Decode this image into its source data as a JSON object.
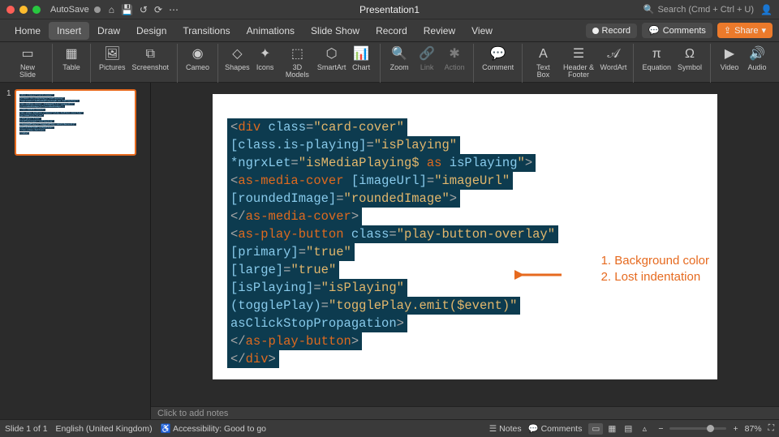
{
  "titlebar": {
    "autosave_label": "AutoSave",
    "doc_title": "Presentation1",
    "search_placeholder": "Search (Cmd + Ctrl + U)"
  },
  "tabs": {
    "items": [
      {
        "label": "Home"
      },
      {
        "label": "Insert"
      },
      {
        "label": "Draw"
      },
      {
        "label": "Design"
      },
      {
        "label": "Transitions"
      },
      {
        "label": "Animations"
      },
      {
        "label": "Slide Show"
      },
      {
        "label": "Record"
      },
      {
        "label": "Review"
      },
      {
        "label": "View"
      }
    ],
    "active_index": 1,
    "record_label": "Record",
    "comments_label": "Comments",
    "share_label": "Share"
  },
  "ribbon": {
    "new_slide": "New Slide",
    "table": "Table",
    "pictures": "Pictures",
    "screenshot": "Screenshot",
    "cameo": "Cameo",
    "shapes": "Shapes",
    "icons": "Icons",
    "models3d": "3D Models",
    "smartart": "SmartArt",
    "chart": "Chart",
    "zoom": "Zoom",
    "link": "Link",
    "action": "Action",
    "comment": "Comment",
    "text_box": "Text Box",
    "header_footer": "Header & Footer",
    "wordart": "WordArt",
    "equation": "Equation",
    "symbol": "Symbol",
    "video": "Video",
    "audio": "Audio"
  },
  "thumbnails": {
    "slide1_num": "1"
  },
  "slide": {
    "code_lines": [
      [
        [
          "br",
          "<"
        ],
        [
          "tag",
          "div"
        ],
        [
          "op",
          " "
        ],
        [
          "attr",
          "class"
        ],
        [
          "op",
          "="
        ],
        [
          "str",
          "\"card-cover\""
        ]
      ],
      [
        [
          "attr",
          "[class.is-playing]"
        ],
        [
          "op",
          "="
        ],
        [
          "str",
          "\"isPlaying\""
        ]
      ],
      [
        [
          "attr",
          "*ngrxLet"
        ],
        [
          "op",
          "="
        ],
        [
          "str",
          "\"isMediaPlaying$ "
        ],
        [
          "tag",
          "as"
        ],
        [
          "str",
          " "
        ],
        [
          "attr",
          "isPlaying"
        ],
        [
          "str",
          "\""
        ],
        [
          "br",
          ">"
        ]
      ],
      [
        [
          "br",
          "<"
        ],
        [
          "tag",
          "as-media-cover"
        ],
        [
          "op",
          " "
        ],
        [
          "attr",
          "[imageUrl]"
        ],
        [
          "op",
          "="
        ],
        [
          "str",
          "\"imageUrl\""
        ]
      ],
      [
        [
          "attr",
          "[roundedImage]"
        ],
        [
          "op",
          "="
        ],
        [
          "str",
          "\"roundedImage\""
        ],
        [
          "br",
          ">"
        ]
      ],
      [
        [
          "br",
          "</"
        ],
        [
          "tag",
          "as-media-cover"
        ],
        [
          "br",
          ">"
        ]
      ],
      [
        [
          "br",
          "<"
        ],
        [
          "tag",
          "as-play-button"
        ],
        [
          "op",
          " "
        ],
        [
          "attr",
          "class"
        ],
        [
          "op",
          "="
        ],
        [
          "str",
          "\"play-button-overlay\""
        ]
      ],
      [
        [
          "attr",
          "[primary]"
        ],
        [
          "op",
          "="
        ],
        [
          "str",
          "\"true\""
        ]
      ],
      [
        [
          "attr",
          "[large]"
        ],
        [
          "op",
          "="
        ],
        [
          "str",
          "\"true\""
        ]
      ],
      [
        [
          "attr",
          "[isPlaying]"
        ],
        [
          "op",
          "="
        ],
        [
          "str",
          "\"isPlaying\""
        ]
      ],
      [
        [
          "attr",
          "(togglePlay)"
        ],
        [
          "op",
          "="
        ],
        [
          "str",
          "\"togglePlay.emit($event)\""
        ]
      ],
      [
        [
          "attr",
          "asClickStopPropagation"
        ],
        [
          "br",
          ">"
        ]
      ],
      [
        [
          "br",
          "</"
        ],
        [
          "tag",
          "as-play-button"
        ],
        [
          "br",
          ">"
        ]
      ],
      [
        [
          "br",
          "</"
        ],
        [
          "tag",
          "div"
        ],
        [
          "br",
          ">"
        ]
      ]
    ],
    "annotation_line1": "1. Background color",
    "annotation_line2": "2. Lost indentation"
  },
  "notes": {
    "placeholder": "Click to add notes"
  },
  "status": {
    "slide_of": "Slide 1 of 1",
    "language": "English (United Kingdom)",
    "accessibility": "Accessibility: Good to go",
    "notes_label": "Notes",
    "comments_label": "Comments",
    "zoom_pct": "87%"
  },
  "colors": {
    "accent": "#ec7a2b"
  }
}
